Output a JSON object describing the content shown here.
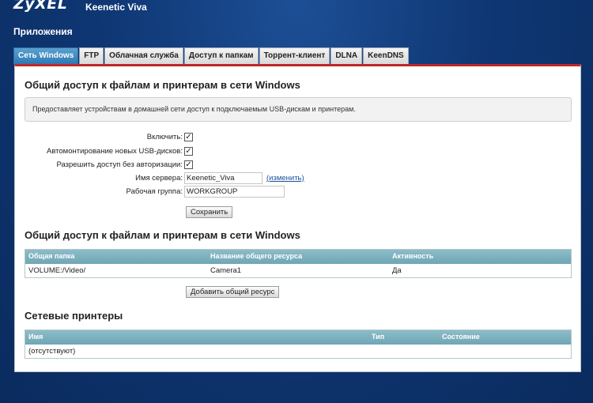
{
  "brand": {
    "logo": "ZyXEL",
    "model": "Keenetic Viva"
  },
  "section_title": "Приложения",
  "tabs": [
    {
      "label": "Сеть Windows",
      "active": true
    },
    {
      "label": "FTP",
      "active": false
    },
    {
      "label": "Облачная служба",
      "active": false
    },
    {
      "label": "Доступ к папкам",
      "active": false
    },
    {
      "label": "Торрент-клиент",
      "active": false
    },
    {
      "label": "DLNA",
      "active": false
    },
    {
      "label": "KeenDNS",
      "active": false
    }
  ],
  "settings": {
    "title": "Общий доступ к файлам и принтерам в сети Windows",
    "description": "Предоставляет устройствам в домашней сети доступ к подключаемым USB-дискам и принтерам.",
    "enable_label": "Включить:",
    "enable_checked": true,
    "automount_label": "Автомонтирование новых USB-дисков:",
    "automount_checked": true,
    "anon_label": "Разрешить доступ без авторизации:",
    "anon_checked": true,
    "server_name_label": "Имя сервера:",
    "server_name_value": "Keenetic_Viva",
    "change_link": "(изменить)",
    "workgroup_label": "Рабочая группа:",
    "workgroup_value": "WORKGROUP",
    "save_button": "Сохранить"
  },
  "shares": {
    "title": "Общий доступ к файлам и принтерам в сети Windows",
    "headers": [
      "Общая папка",
      "Название общего ресурса",
      "Активность"
    ],
    "rows": [
      [
        "VOLUME:/Video/",
        "Camera1",
        "Да"
      ]
    ],
    "add_button": "Добавить общий ресурс"
  },
  "printers": {
    "title": "Сетевые принтеры",
    "headers": [
      "Имя",
      "Тип",
      "Состояние"
    ],
    "rows": [
      [
        "(отсутствуют)",
        "",
        ""
      ]
    ]
  },
  "colors": {
    "accent_red": "#c0282a",
    "tab_active": "#2f79b5",
    "table_header": "#7fb1bf",
    "background": "#0f3774"
  }
}
